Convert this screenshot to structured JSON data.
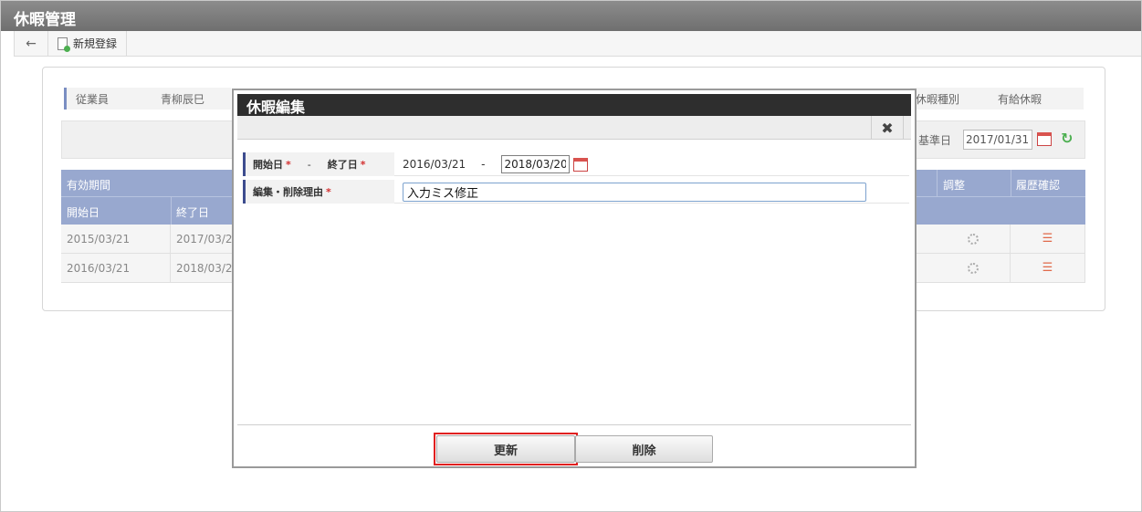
{
  "app": {
    "title": "休暇管理"
  },
  "toolbar": {
    "back_icon": "arrow-left-icon",
    "new_label": "新規登録"
  },
  "info": {
    "employee_label": "従業員",
    "employee_value": "青柳辰巳",
    "leave_type_label": "休暇種別",
    "leave_type_value": "有給休暇"
  },
  "filter": {
    "base_date_label": "基準日",
    "base_date_value": "2017/01/31"
  },
  "grid": {
    "group_header": "有効期間",
    "columns": [
      "開始日",
      "終了日"
    ],
    "adjust_header": "調整",
    "history_header": "履歴確認",
    "rows": [
      {
        "start": "2015/03/21",
        "end": "2017/03/20"
      },
      {
        "start": "2016/03/21",
        "end": "2018/03/20"
      }
    ]
  },
  "modal": {
    "title": "休暇編集",
    "close_icon": "close-icon",
    "period_start_label": "開始日",
    "period_sep": "-",
    "period_end_label": "終了日",
    "start_value": "2016/03/21",
    "value_sep": "-",
    "end_value": "2018/03/20",
    "reason_label": "編集・削除理由",
    "reason_value": "入力ミス修正",
    "update_label": "更新",
    "delete_label": "削除"
  },
  "colors": {
    "accent": "#3d4c8e",
    "highlight": "#e02020",
    "grid_header": "#98a8cf"
  }
}
